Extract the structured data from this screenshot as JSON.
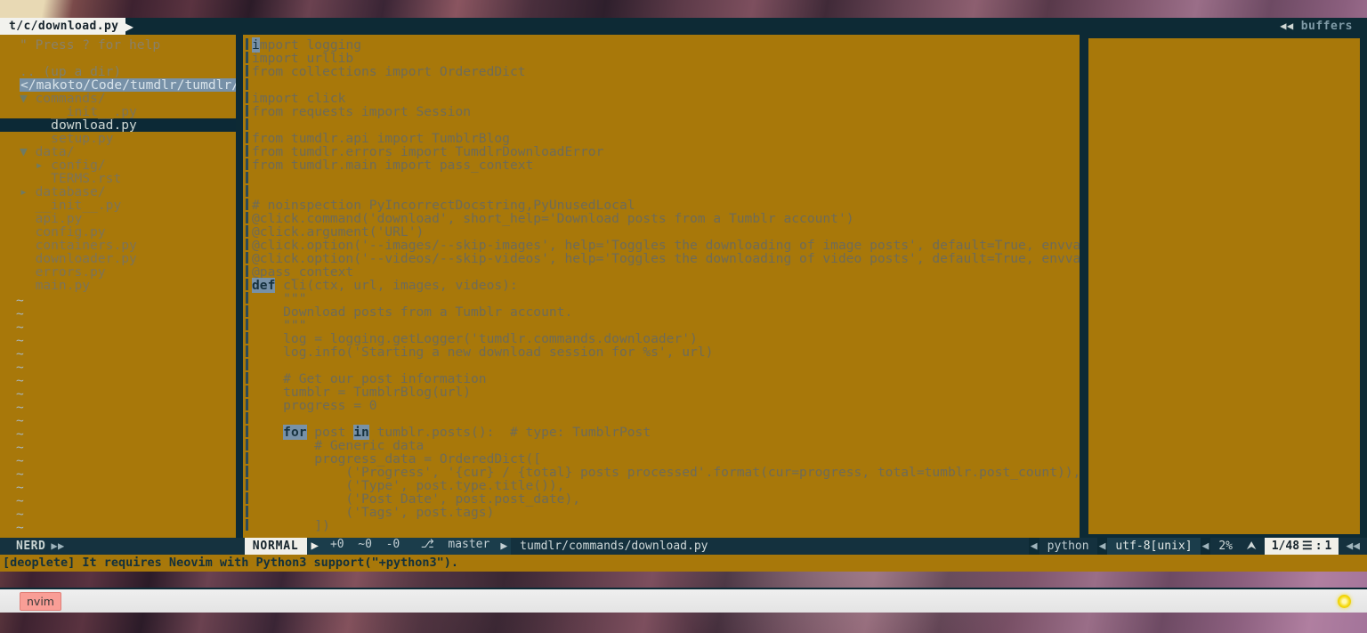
{
  "window": {
    "tab_label": "t/c/download.py",
    "tab_arrow": "▶",
    "buffers_label": "buffers",
    "buffers_arrow": "◀◀"
  },
  "nerdtree": {
    "help_line": "\" Press ? for help",
    "up_dir": ".. (up a dir)",
    "selected_path": "</makoto/Code/tumdlr/tumdlr/",
    "entries": [
      {
        "indent": 0,
        "caret": "▼",
        "label": "commands/",
        "type": "dir"
      },
      {
        "indent": 1,
        "caret": "",
        "label": "__init__.py",
        "type": "file"
      },
      {
        "indent": 1,
        "caret": "",
        "label": "download.py",
        "type": "file",
        "cursor": true
      },
      {
        "indent": 1,
        "caret": "",
        "label": "setup.py",
        "type": "file"
      },
      {
        "indent": 0,
        "caret": "▼",
        "label": "data/",
        "type": "dir"
      },
      {
        "indent": 1,
        "caret": "▸",
        "label": "config/",
        "type": "dir"
      },
      {
        "indent": 1,
        "caret": "",
        "label": "TERMS.rst",
        "type": "file"
      },
      {
        "indent": 0,
        "caret": "▸",
        "label": "database/",
        "type": "dir"
      },
      {
        "indent": 0,
        "caret": "",
        "label": "__init__.py",
        "type": "file"
      },
      {
        "indent": 0,
        "caret": "",
        "label": "api.py",
        "type": "file"
      },
      {
        "indent": 0,
        "caret": "",
        "label": "config.py",
        "type": "file"
      },
      {
        "indent": 0,
        "caret": "",
        "label": "containers.py",
        "type": "file"
      },
      {
        "indent": 0,
        "caret": "",
        "label": "downloader.py",
        "type": "file"
      },
      {
        "indent": 0,
        "caret": "",
        "label": "errors.py",
        "type": "file"
      },
      {
        "indent": 0,
        "caret": "",
        "label": "main.py",
        "type": "file"
      }
    ],
    "empty_marker": "~",
    "empty_count": 19
  },
  "editor": {
    "lines": [
      "import logging",
      "import urllib",
      "from collections import OrderedDict",
      "",
      "import click",
      "from requests import Session",
      "",
      "from tumdlr.api import TumblrBlog",
      "from tumdlr.errors import TumdlrDownloadError",
      "from tumdlr.main import pass_context",
      "",
      "",
      "# noinspection PyIncorrectDocstring,PyUnusedLocal",
      "@click.command('download', short_help='Download posts from a Tumblr account')",
      "@click.argument('URL')",
      "@click.option('--images/--skip-images', help='Toggles the downloading of image posts', default=True, envvar='IMAGES')",
      "@click.option('--videos/--skip-videos', help='Toggles the downloading of video posts', default=True, envvar='VIDEOS')",
      "@pass_context",
      "def cli(ctx, url, images, videos):",
      "    \"\"\"",
      "    Download posts from a Tumblr account.",
      "    \"\"\"",
      "    log = logging.getLogger('tumdlr.commands.downloader')",
      "    log.info('Starting a new download session for %s', url)",
      "",
      "    # Get our post information",
      "    tumblr = TumblrBlog(url)",
      "    progress = 0",
      "",
      "    for post in tumblr.posts():  # type: TumblrPost",
      "        # Generic data",
      "        progress_data = OrderedDict([",
      "            ('Progress', '{cur} / {total} posts processed'.format(cur=progress, total=tumblr.post_count)),",
      "            ('Type', post.type.title()),",
      "            ('Post Date', post.post_date),",
      "            ('Tags', post.tags)",
      "        ])"
    ],
    "keywords": [
      {
        "line": 18,
        "col": 0,
        "text": "def"
      },
      {
        "line": 29,
        "col": 4,
        "text": "for"
      },
      {
        "line": 29,
        "col": 13,
        "text": "in"
      }
    ],
    "cursor": {
      "line": 0,
      "col": 0,
      "char": "i"
    }
  },
  "statusline": {
    "nerd_label": "NERD",
    "nerd_arrow": "▶▶",
    "mode": "NORMAL",
    "sep": "▶",
    "git_added": "+0",
    "git_modified": "~0",
    "git_removed": "-0",
    "branch_icon": "⎇",
    "branch": "master",
    "file_path": "tumdlr/commands/download.py",
    "sep_left": "◀",
    "filetype": "python",
    "encoding": "utf-8[unix]",
    "percent": "2%",
    "percent_icon": "⮝",
    "line_total": "1/48",
    "lines_icon": "☰",
    "colon": ":",
    "column": "1",
    "end_arrow": "◀◀"
  },
  "message": "[deoplete] It requires Neovim with Python3 support(\"+python3\").",
  "taskbar": {
    "window_button": "nvim",
    "tray_icon": "status-light-icon"
  },
  "colors": {
    "background_gold": "#a8780a",
    "panel_dark": "#0d2a35",
    "accent_blue": "#7791a8",
    "cursorline": "#0c2936",
    "statusline_light": "#f0efe9"
  }
}
